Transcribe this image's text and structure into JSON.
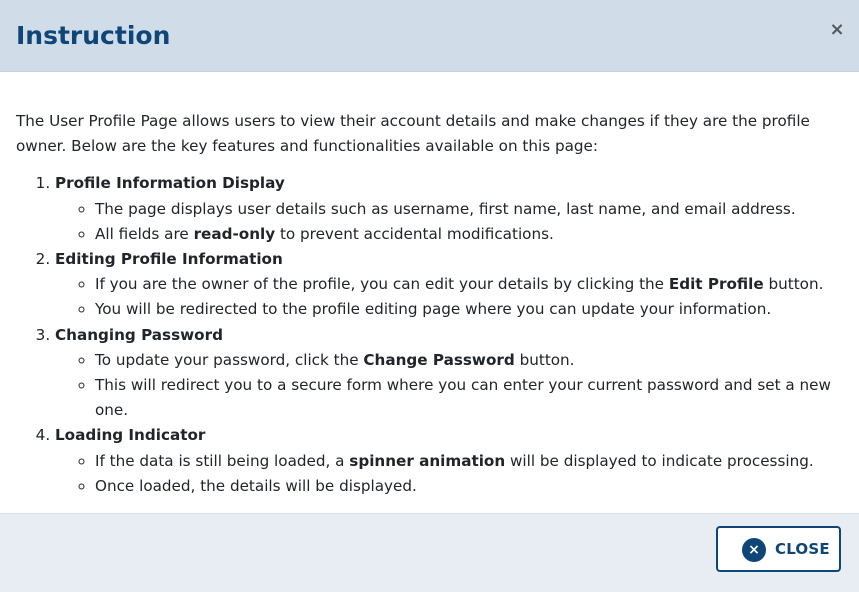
{
  "dialog": {
    "title": "Instruction",
    "close_icon": "×"
  },
  "content": {
    "intro": "The User Profile Page allows users to view their account details and make changes if they are the profile owner. Below are the key features and functionalities available on this page:",
    "sections": [
      {
        "title": "Profile Information Display",
        "items": [
          {
            "parts": [
              {
                "text": "The page displays user details such as username, first name, last name, and email address.",
                "bold": false
              }
            ]
          },
          {
            "parts": [
              {
                "text": "All fields are ",
                "bold": false
              },
              {
                "text": "read-only",
                "bold": true
              },
              {
                "text": " to prevent accidental modifications.",
                "bold": false
              }
            ]
          }
        ]
      },
      {
        "title": "Editing Profile Information",
        "items": [
          {
            "parts": [
              {
                "text": "If you are the owner of the profile, you can edit your details by clicking the ",
                "bold": false
              },
              {
                "text": "Edit Profile",
                "bold": true
              },
              {
                "text": " button.",
                "bold": false
              }
            ]
          },
          {
            "parts": [
              {
                "text": "You will be redirected to the profile editing page where you can update your information.",
                "bold": false
              }
            ]
          }
        ]
      },
      {
        "title": "Changing Password",
        "items": [
          {
            "parts": [
              {
                "text": "To update your password, click the ",
                "bold": false
              },
              {
                "text": "Change Password",
                "bold": true
              },
              {
                "text": " button.",
                "bold": false
              }
            ]
          },
          {
            "parts": [
              {
                "text": "This will redirect you to a secure form where you can enter your current password and set a new one.",
                "bold": false
              }
            ]
          }
        ]
      },
      {
        "title": "Loading Indicator",
        "items": [
          {
            "parts": [
              {
                "text": "If the data is still being loaded, a ",
                "bold": false
              },
              {
                "text": "spinner animation",
                "bold": true
              },
              {
                "text": " will be displayed to indicate processing.",
                "bold": false
              }
            ]
          },
          {
            "parts": [
              {
                "text": "Once loaded, the details will be displayed.",
                "bold": false
              }
            ]
          }
        ]
      }
    ]
  },
  "footer": {
    "close_button_label": "CLOSE",
    "close_button_icon": "×"
  },
  "colors": {
    "header_bg": "#d0dce7",
    "title": "#0d4677",
    "footer_bg": "#e7edf3",
    "accent": "#0d4677",
    "text": "#212529"
  },
  "icons": {
    "header_close": "close-icon",
    "button_close": "close-circle-icon"
  }
}
